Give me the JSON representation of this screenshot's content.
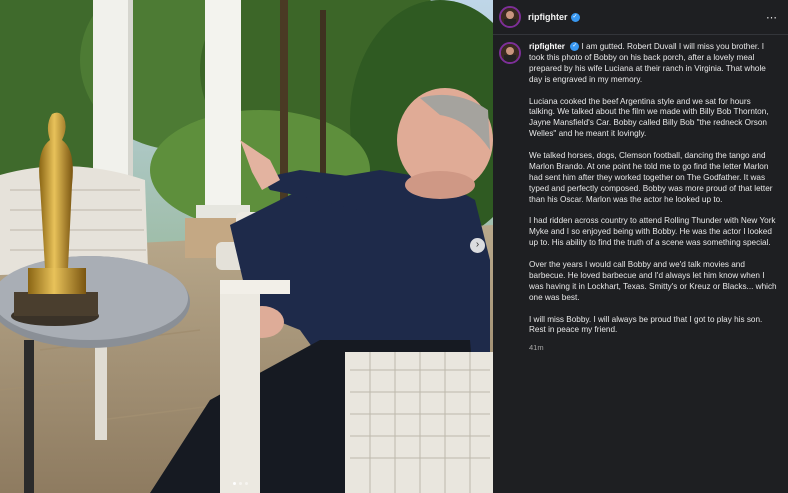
{
  "post": {
    "username": "ripfighter",
    "verified": true,
    "caption_paragraphs": [
      "I am gutted. Robert Duvall I will miss you brother. I took this photo of Bobby on his back porch, after a lovely meal prepared by his wife Luciana at their ranch in Virginia. That whole day is engraved in my memory.",
      "Luciana cooked the beef Argentina style and we sat for hours talking. We talked about the film we made with Billy Bob Thornton, Jayne Mansfield's Car. Bobby called Billy Bob \"the redneck Orson Welles\" and he meant it lovingly.",
      "We talked horses, dogs, Clemson football, dancing the tango and Marlon Brando. At one point he told me to go find the letter Marlon had sent him after they worked together on The Godfather. It was typed and perfectly composed. Bobby was more proud of that letter than his Oscar. Marlon was the actor he looked up to.",
      "I had ridden across country to attend Rolling Thunder with New York Myke and I so enjoyed being with Bobby. He was the actor I looked up to. His ability to find the truth of a scene was something special.",
      "Over the years I would call Bobby and we'd talk movies and barbecue. He loved barbecue and I'd always let him know when I was having it in Lockhart, Texas. Smitty's or Kreuz or Blacks... which one was best.",
      "I will miss Bobby. I will always be proud that I got to play his son. Rest in peace my friend."
    ],
    "timestamp": "41m",
    "more_icon": "⋯",
    "next_icon": "›"
  },
  "colors": {
    "panel_bg": "#1e1f22",
    "avatar_ring": "#7d2f98",
    "verified": "#3897f0"
  }
}
